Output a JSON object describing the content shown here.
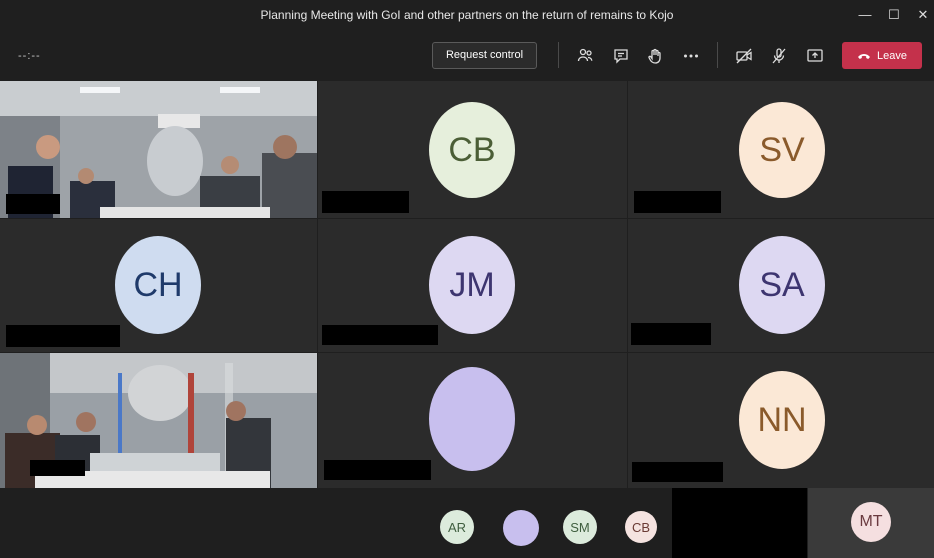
{
  "window": {
    "title": "Planning Meeting with GoI and other partners on the return of remains to Kojo",
    "minimize_glyph": "—",
    "maximize_glyph": "☐",
    "close_glyph": "✕"
  },
  "toolbar": {
    "timer": "--:--",
    "request_control_label": "Request control",
    "icons": [
      "participants-icon",
      "chat-icon",
      "raise-hand-icon",
      "more-options-icon",
      "camera-off-icon",
      "mic-off-icon",
      "share-screen-icon"
    ],
    "leave_label": "Leave",
    "leave_color": "#c4314b"
  },
  "grid": [
    {
      "type": "video",
      "scene": "room-1"
    },
    {
      "type": "avatar",
      "initials": "CB",
      "bg": "#e6efdc",
      "fg": "#4b5e36"
    },
    {
      "type": "avatar",
      "initials": "SV",
      "bg": "#fbe8d6",
      "fg": "#8a5a2b"
    },
    {
      "type": "avatar",
      "initials": "CH",
      "bg": "#cfdcf0",
      "fg": "#1f3a6a"
    },
    {
      "type": "avatar",
      "initials": "JM",
      "bg": "#ddd8f2",
      "fg": "#3d3570"
    },
    {
      "type": "avatar",
      "initials": "SA",
      "bg": "#ddd8f2",
      "fg": "#3d3570"
    },
    {
      "type": "video",
      "scene": "room-2"
    },
    {
      "type": "avatar",
      "initials": "",
      "bg": "#c8bfee",
      "fg": "#3d3570"
    },
    {
      "type": "avatar",
      "initials": "NN",
      "bg": "#fbe8d6",
      "fg": "#8a5a2b"
    }
  ],
  "strip": [
    {
      "initials": "AR",
      "bg": "#dcebdc",
      "fg": "#3f5e3f"
    },
    {
      "initials": "",
      "bg": "#c8bfee",
      "fg": "#3d3570"
    },
    {
      "initials": "SM",
      "bg": "#dcebdc",
      "fg": "#3f5e3f"
    },
    {
      "initials": "CB",
      "bg": "#f5e3e0",
      "fg": "#6a3a34"
    },
    {
      "initials": "MT",
      "bg": "#f5dfe0",
      "fg": "#6a3a3f"
    }
  ]
}
